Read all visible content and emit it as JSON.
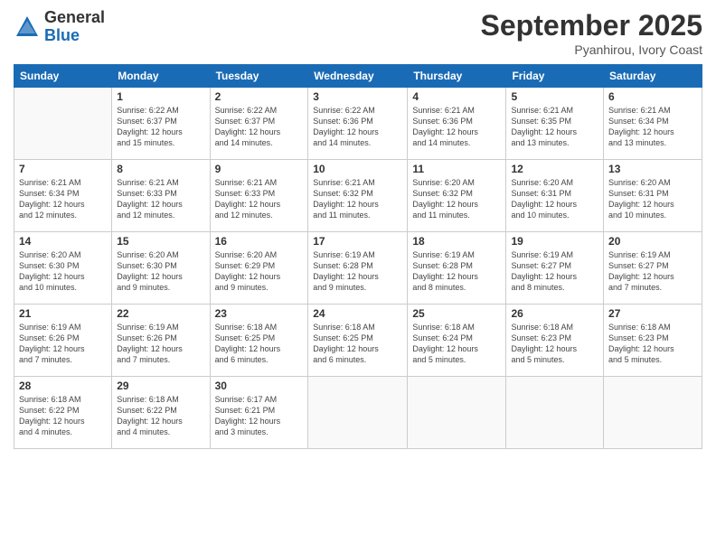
{
  "logo": {
    "general": "General",
    "blue": "Blue"
  },
  "title": "September 2025",
  "location": "Pyanhirou, Ivory Coast",
  "days_header": [
    "Sunday",
    "Monday",
    "Tuesday",
    "Wednesday",
    "Thursday",
    "Friday",
    "Saturday"
  ],
  "weeks": [
    [
      {
        "num": "",
        "info": ""
      },
      {
        "num": "1",
        "info": "Sunrise: 6:22 AM\nSunset: 6:37 PM\nDaylight: 12 hours\nand 15 minutes."
      },
      {
        "num": "2",
        "info": "Sunrise: 6:22 AM\nSunset: 6:37 PM\nDaylight: 12 hours\nand 14 minutes."
      },
      {
        "num": "3",
        "info": "Sunrise: 6:22 AM\nSunset: 6:36 PM\nDaylight: 12 hours\nand 14 minutes."
      },
      {
        "num": "4",
        "info": "Sunrise: 6:21 AM\nSunset: 6:36 PM\nDaylight: 12 hours\nand 14 minutes."
      },
      {
        "num": "5",
        "info": "Sunrise: 6:21 AM\nSunset: 6:35 PM\nDaylight: 12 hours\nand 13 minutes."
      },
      {
        "num": "6",
        "info": "Sunrise: 6:21 AM\nSunset: 6:34 PM\nDaylight: 12 hours\nand 13 minutes."
      }
    ],
    [
      {
        "num": "7",
        "info": "Sunrise: 6:21 AM\nSunset: 6:34 PM\nDaylight: 12 hours\nand 12 minutes."
      },
      {
        "num": "8",
        "info": "Sunrise: 6:21 AM\nSunset: 6:33 PM\nDaylight: 12 hours\nand 12 minutes."
      },
      {
        "num": "9",
        "info": "Sunrise: 6:21 AM\nSunset: 6:33 PM\nDaylight: 12 hours\nand 12 minutes."
      },
      {
        "num": "10",
        "info": "Sunrise: 6:21 AM\nSunset: 6:32 PM\nDaylight: 12 hours\nand 11 minutes."
      },
      {
        "num": "11",
        "info": "Sunrise: 6:20 AM\nSunset: 6:32 PM\nDaylight: 12 hours\nand 11 minutes."
      },
      {
        "num": "12",
        "info": "Sunrise: 6:20 AM\nSunset: 6:31 PM\nDaylight: 12 hours\nand 10 minutes."
      },
      {
        "num": "13",
        "info": "Sunrise: 6:20 AM\nSunset: 6:31 PM\nDaylight: 12 hours\nand 10 minutes."
      }
    ],
    [
      {
        "num": "14",
        "info": "Sunrise: 6:20 AM\nSunset: 6:30 PM\nDaylight: 12 hours\nand 10 minutes."
      },
      {
        "num": "15",
        "info": "Sunrise: 6:20 AM\nSunset: 6:30 PM\nDaylight: 12 hours\nand 9 minutes."
      },
      {
        "num": "16",
        "info": "Sunrise: 6:20 AM\nSunset: 6:29 PM\nDaylight: 12 hours\nand 9 minutes."
      },
      {
        "num": "17",
        "info": "Sunrise: 6:19 AM\nSunset: 6:28 PM\nDaylight: 12 hours\nand 9 minutes."
      },
      {
        "num": "18",
        "info": "Sunrise: 6:19 AM\nSunset: 6:28 PM\nDaylight: 12 hours\nand 8 minutes."
      },
      {
        "num": "19",
        "info": "Sunrise: 6:19 AM\nSunset: 6:27 PM\nDaylight: 12 hours\nand 8 minutes."
      },
      {
        "num": "20",
        "info": "Sunrise: 6:19 AM\nSunset: 6:27 PM\nDaylight: 12 hours\nand 7 minutes."
      }
    ],
    [
      {
        "num": "21",
        "info": "Sunrise: 6:19 AM\nSunset: 6:26 PM\nDaylight: 12 hours\nand 7 minutes."
      },
      {
        "num": "22",
        "info": "Sunrise: 6:19 AM\nSunset: 6:26 PM\nDaylight: 12 hours\nand 7 minutes."
      },
      {
        "num": "23",
        "info": "Sunrise: 6:18 AM\nSunset: 6:25 PM\nDaylight: 12 hours\nand 6 minutes."
      },
      {
        "num": "24",
        "info": "Sunrise: 6:18 AM\nSunset: 6:25 PM\nDaylight: 12 hours\nand 6 minutes."
      },
      {
        "num": "25",
        "info": "Sunrise: 6:18 AM\nSunset: 6:24 PM\nDaylight: 12 hours\nand 5 minutes."
      },
      {
        "num": "26",
        "info": "Sunrise: 6:18 AM\nSunset: 6:23 PM\nDaylight: 12 hours\nand 5 minutes."
      },
      {
        "num": "27",
        "info": "Sunrise: 6:18 AM\nSunset: 6:23 PM\nDaylight: 12 hours\nand 5 minutes."
      }
    ],
    [
      {
        "num": "28",
        "info": "Sunrise: 6:18 AM\nSunset: 6:22 PM\nDaylight: 12 hours\nand 4 minutes."
      },
      {
        "num": "29",
        "info": "Sunrise: 6:18 AM\nSunset: 6:22 PM\nDaylight: 12 hours\nand 4 minutes."
      },
      {
        "num": "30",
        "info": "Sunrise: 6:17 AM\nSunset: 6:21 PM\nDaylight: 12 hours\nand 3 minutes."
      },
      {
        "num": "",
        "info": ""
      },
      {
        "num": "",
        "info": ""
      },
      {
        "num": "",
        "info": ""
      },
      {
        "num": "",
        "info": ""
      }
    ]
  ]
}
